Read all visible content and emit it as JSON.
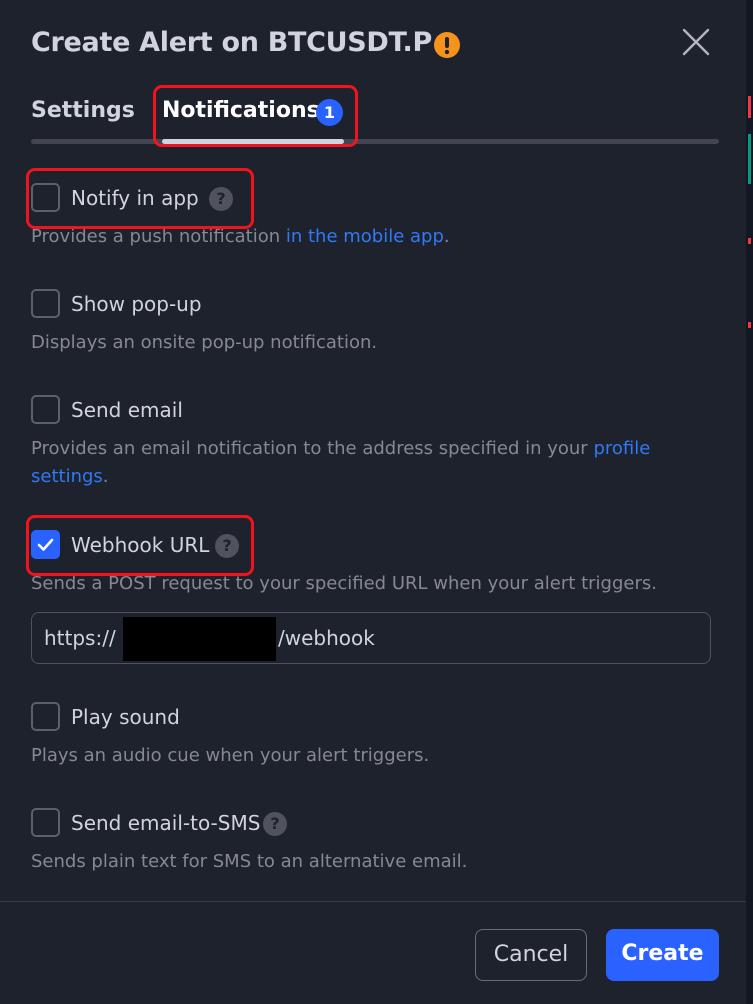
{
  "dialog": {
    "title": "Create Alert on BTCUSDT.P",
    "warning_icon": "warning-icon",
    "close_icon": "close-icon"
  },
  "tabs": [
    {
      "label": "Settings",
      "active": false
    },
    {
      "label": "Notifications",
      "active": true,
      "badge": "1"
    }
  ],
  "options": [
    {
      "label": "Notify in app",
      "checked": false,
      "has_help": true,
      "help_glyph": "?",
      "description_pre": "Provides a push notification ",
      "description_link": "in the mobile app",
      "description_post": "."
    },
    {
      "label": "Show pop-up",
      "checked": false,
      "description": "Displays an onsite pop-up notification."
    },
    {
      "label": "Send email",
      "checked": false,
      "description_pre": "Provides an email notification to the address specified in your ",
      "description_link": "profile settings",
      "description_post": "."
    },
    {
      "label": "Webhook URL",
      "checked": true,
      "has_help": true,
      "help_glyph": "?",
      "description": "Sends a POST request to your specified URL when your alert triggers.",
      "url_prefix": "https://",
      "url_suffix": "/webhook"
    },
    {
      "label": "Play sound",
      "checked": false,
      "description": "Plays an audio cue when your alert triggers."
    },
    {
      "label": "Send email-to-SMS",
      "checked": false,
      "has_help": true,
      "help_glyph": "?",
      "description": "Sends plain text for SMS to an alternative email."
    }
  ],
  "footer": {
    "cancel_label": "Cancel",
    "create_label": "Create"
  },
  "colors": {
    "background": "#1e222d",
    "accent": "#2962ff",
    "link": "#3179f5",
    "warning": "#f7931a",
    "highlight": "#f0141e"
  }
}
